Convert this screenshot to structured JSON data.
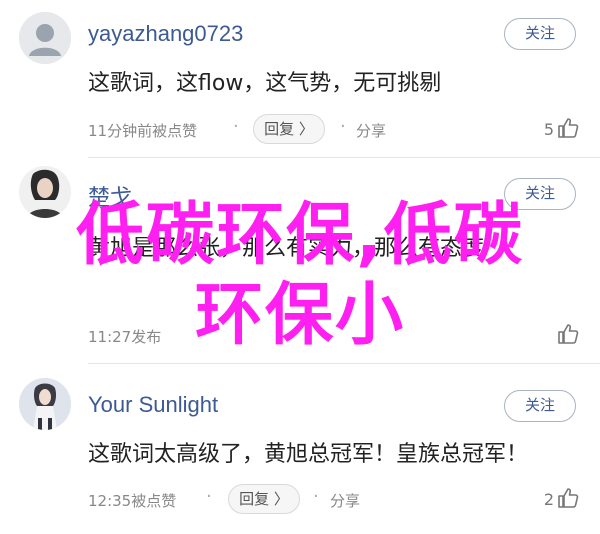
{
  "comments": [
    {
      "username": "yayazhang0723",
      "follow_label": "关注",
      "text": "这歌词，这flow，这气势，无可挑剔",
      "time": "11分钟前被点赞",
      "reply_label": "回复 〉",
      "share_label": "分享",
      "likes": "5"
    },
    {
      "username": "楚戈",
      "follow_label": "关注",
      "text": "黄旭是那么张，那么有实力，那么有态度",
      "time": "11:27发布",
      "likes": ""
    },
    {
      "username": "Your Sunlight",
      "follow_label": "关注",
      "text": "这歌词太高级了，黄旭总冠军！皇族总冠军！",
      "time": "12:35被点赞",
      "reply_label": "回复 〉",
      "share_label": "分享",
      "likes": "2"
    }
  ],
  "overlay": {
    "line1": "低碳环保,低碳",
    "line2": "环保小"
  },
  "colors": {
    "username": "#3c5a93",
    "overlay": "#ff1ff0"
  },
  "icons": [
    "user-placeholder-icon",
    "thumbs-up-icon"
  ]
}
